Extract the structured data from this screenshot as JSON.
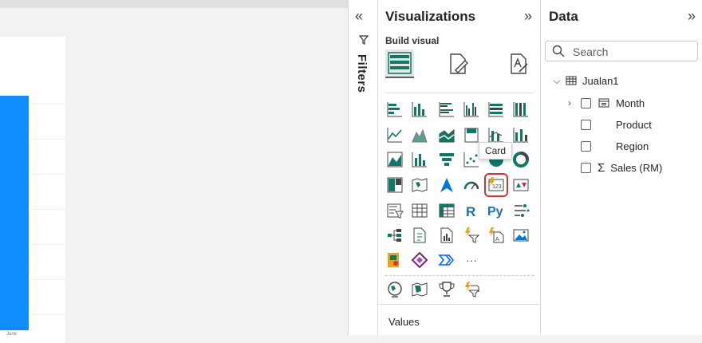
{
  "canvas": {
    "x_tick": "June"
  },
  "filters": {
    "label": "Filters",
    "collapse_glyph": "«"
  },
  "visualizations": {
    "title": "Visualizations",
    "expand_glyph": "»",
    "build_label": "Build visual",
    "tooltip": "Card",
    "more_glyph": "···",
    "values_label": "Values"
  },
  "data_pane": {
    "title": "Data",
    "expand_glyph": "»",
    "search_placeholder": "Search",
    "table_name": "Jualan1",
    "fields": [
      {
        "label": "Month"
      },
      {
        "label": "Product"
      },
      {
        "label": "Region"
      },
      {
        "label": "Sales (RM)"
      }
    ]
  },
  "colors": {
    "accent_blue": "#118dff",
    "selection_red": "#d13438",
    "teal": "#117865"
  }
}
